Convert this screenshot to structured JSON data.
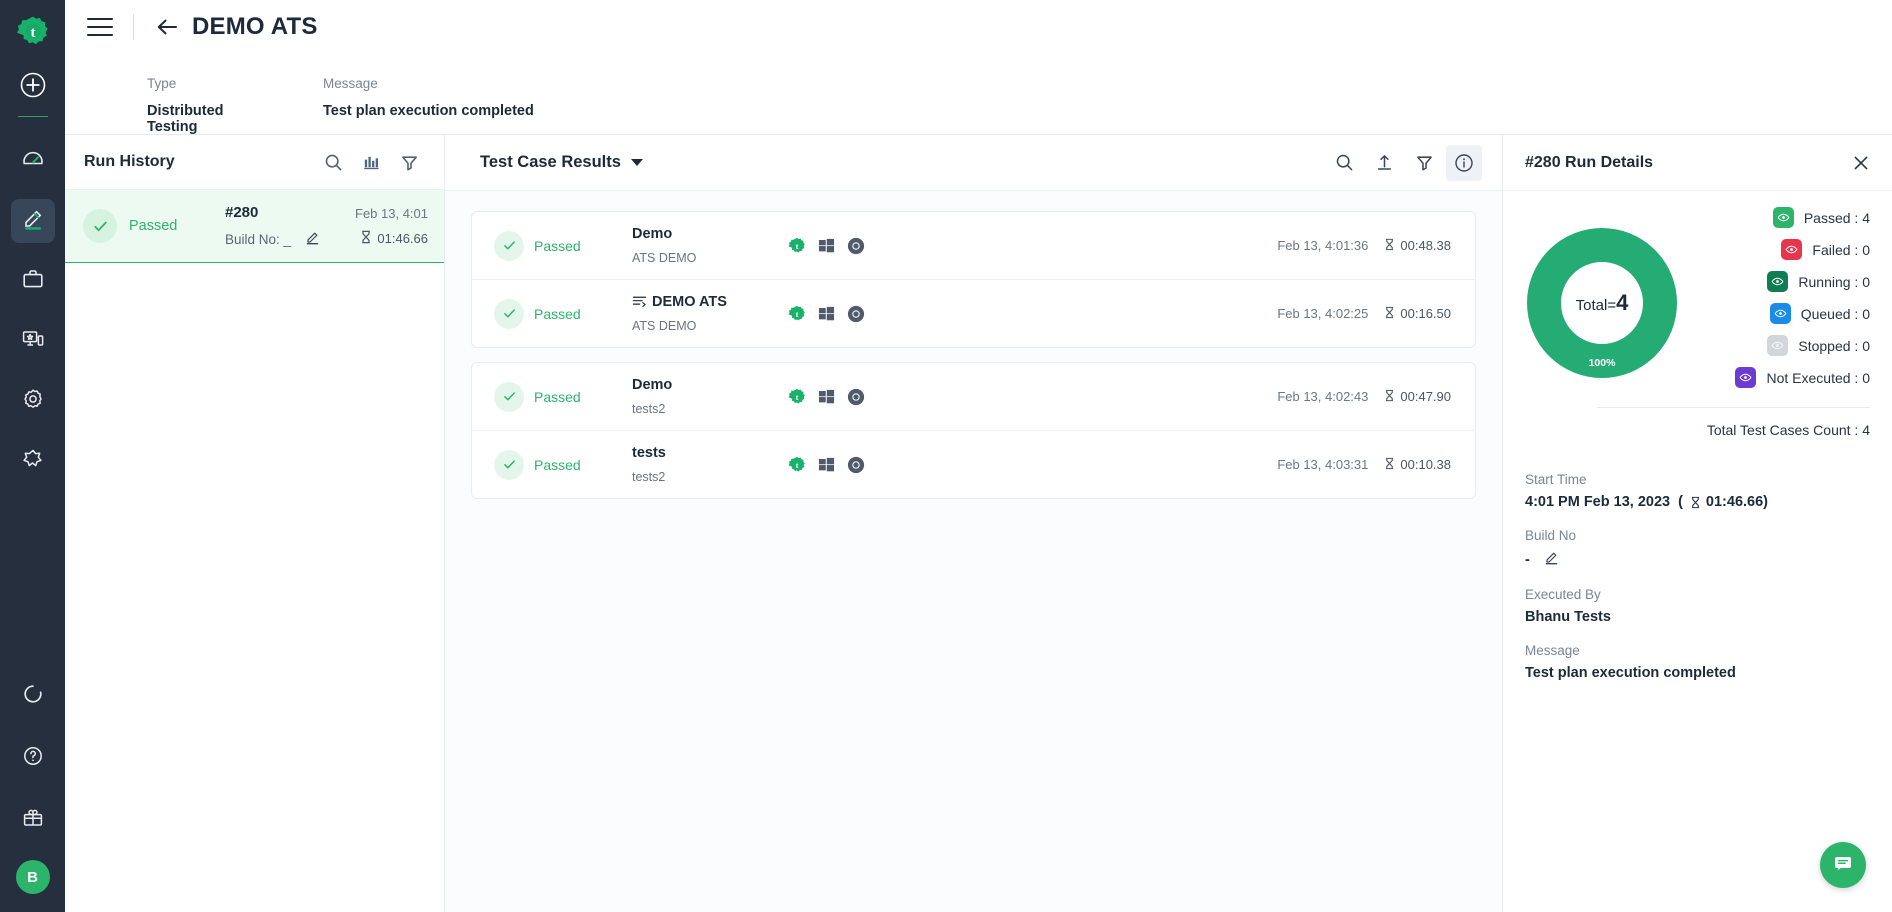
{
  "colors": {
    "rail_bg": "#252f3e",
    "brand_green": "#2cb46b",
    "donut_green": "#25ab74",
    "failed_red": "#e8354e",
    "running_dark_green": "#0f7d54",
    "queued_blue": "#1a8ce8",
    "stopped_grey": "#d2d6db",
    "not_executed_purple": "#6d3bd4",
    "text_dark": "#1c2a3a",
    "text_muted": "#7a8595"
  },
  "rail": {
    "logo": "testsigma-logo-icon",
    "add_label": "plus-icon",
    "items": [
      {
        "icon": "dashboard-gauge-icon",
        "name": "dashboard",
        "active": false
      },
      {
        "icon": "pencil-edit-icon",
        "name": "create-tests",
        "active": true
      },
      {
        "icon": "briefcase-icon",
        "name": "test-plans",
        "active": false
      },
      {
        "icon": "devices-lab-icon",
        "name": "test-lab",
        "active": false
      },
      {
        "icon": "gear-settings-icon",
        "name": "settings",
        "active": false
      },
      {
        "icon": "puzzle-addons-icon",
        "name": "addons",
        "active": false
      }
    ],
    "bottom_items": [
      {
        "icon": "progress-ring-icon",
        "name": "progress"
      },
      {
        "icon": "help-question-icon",
        "name": "help"
      },
      {
        "icon": "gift-icon",
        "name": "whats-new"
      }
    ],
    "avatar_initial": "B"
  },
  "topbar": {
    "menu_icon": "hamburger-menu-icon",
    "back_icon": "back-arrow-icon",
    "title": "DEMO ATS"
  },
  "meta": [
    {
      "label": "Type",
      "value": "Distributed Testing"
    },
    {
      "label": "Message",
      "value": "Test plan execution completed"
    }
  ],
  "run_history": {
    "title": "Run History",
    "icons": [
      {
        "name": "search-icon"
      },
      {
        "name": "bar-chart-icon"
      },
      {
        "name": "filter-icon"
      }
    ],
    "rows": [
      {
        "status": "Passed",
        "id": "#280",
        "build_label": "Build No: _",
        "date": "Feb 13, 4:01",
        "duration": "01:46.66",
        "selected": true
      }
    ]
  },
  "results": {
    "title": "Test Case Results",
    "icons": [
      {
        "name": "search-icon",
        "active": false
      },
      {
        "name": "export-upload-icon",
        "active": false
      },
      {
        "name": "filter-icon",
        "active": false
      },
      {
        "name": "info-icon",
        "active": true
      }
    ],
    "groups": [
      {
        "rows": [
          {
            "status": "Passed",
            "name": "Demo",
            "has_flow_icon": false,
            "sub": "ATS DEMO",
            "platforms": [
              "testsigma-icon",
              "windows-icon",
              "chrome-icon"
            ],
            "date": "Feb 13, 4:01:36",
            "duration": "00:48.38"
          },
          {
            "status": "Passed",
            "name": "DEMO ATS",
            "has_flow_icon": true,
            "sub": "ATS DEMO",
            "platforms": [
              "testsigma-icon",
              "windows-icon",
              "chrome-icon"
            ],
            "date": "Feb 13, 4:02:25",
            "duration": "00:16.50"
          }
        ]
      },
      {
        "rows": [
          {
            "status": "Passed",
            "name": "Demo",
            "has_flow_icon": false,
            "sub": "tests2",
            "platforms": [
              "testsigma-icon",
              "windows-icon",
              "chrome-icon"
            ],
            "date": "Feb 13, 4:02:43",
            "duration": "00:47.90"
          },
          {
            "status": "Passed",
            "name": "tests",
            "has_flow_icon": false,
            "sub": "tests2",
            "platforms": [
              "testsigma-icon",
              "windows-icon",
              "chrome-icon"
            ],
            "date": "Feb 13, 4:03:31",
            "duration": "00:10.38"
          }
        ]
      }
    ]
  },
  "details": {
    "title": "#280 Run Details",
    "close_icon": "close-icon",
    "donut": {
      "center_prefix": "Total=",
      "center_value": "4",
      "percent_label": "100%"
    },
    "legend": [
      {
        "label": "Passed : 4",
        "color": "#2cb46b"
      },
      {
        "label": "Failed : 0",
        "color": "#e8354e"
      },
      {
        "label": "Running : 0",
        "color": "#0f7d54"
      },
      {
        "label": "Queued : 0",
        "color": "#1a8ce8"
      },
      {
        "label": "Stopped : 0",
        "color": "#d2d6db"
      },
      {
        "label": "Not Executed : 0",
        "color": "#6d3bd4"
      }
    ],
    "total_count": "Total Test Cases Count : 4",
    "fields": [
      {
        "label": "Start Time",
        "value": "4:01 PM Feb 13, 2023",
        "extra": "( 01:46.66)",
        "has_hourglass": true,
        "has_pencil": false
      },
      {
        "label": "Build No",
        "value": "-",
        "has_hourglass": false,
        "has_pencil": true
      },
      {
        "label": "Executed By",
        "value": "Bhanu Tests",
        "has_hourglass": false,
        "has_pencil": false
      },
      {
        "label": "Message",
        "value": "Test plan execution completed",
        "has_hourglass": false,
        "has_pencil": false
      }
    ]
  },
  "chat_fab": {
    "icon": "chat-bubble-icon"
  },
  "chart_data": {
    "type": "pie",
    "title": "#280 Run Details test case status breakdown",
    "categories": [
      "Passed",
      "Failed",
      "Running",
      "Queued",
      "Stopped",
      "Not Executed"
    ],
    "values": [
      4,
      0,
      0,
      0,
      0,
      0
    ],
    "colors": [
      "#2cb46b",
      "#e8354e",
      "#0f7d54",
      "#1a8ce8",
      "#d2d6db",
      "#6d3bd4"
    ],
    "total": 4,
    "percent_of_total": "100%",
    "center_label": "Total=4",
    "legend_position": "right",
    "donut": true
  }
}
